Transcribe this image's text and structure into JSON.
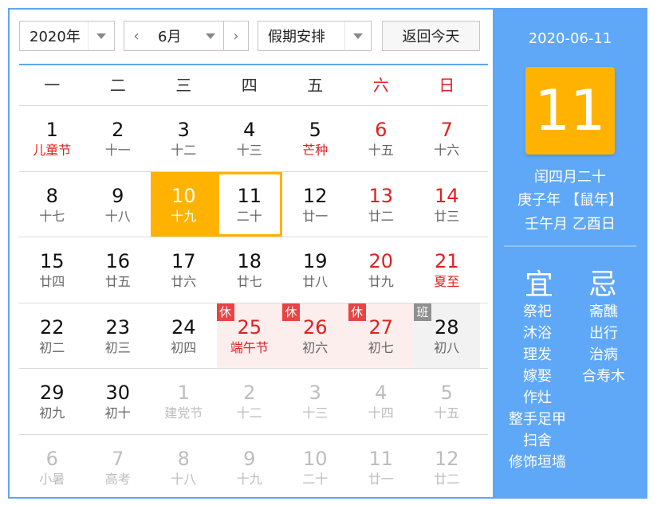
{
  "toolbar": {
    "year": "2020年",
    "month": "6月",
    "holiday": "假期安排",
    "prev": "‹",
    "next": "›",
    "today_btn": "返回今天"
  },
  "weekdays": [
    "一",
    "二",
    "三",
    "四",
    "五",
    "六",
    "日"
  ],
  "rows": [
    [
      {
        "d": "1",
        "l": "儿童节",
        "cls": "fest"
      },
      {
        "d": "2",
        "l": "十一",
        "cls": ""
      },
      {
        "d": "3",
        "l": "十二",
        "cls": ""
      },
      {
        "d": "4",
        "l": "十三",
        "cls": ""
      },
      {
        "d": "5",
        "l": "芒种",
        "cls": "fest"
      },
      {
        "d": "6",
        "l": "十五",
        "cls": "we"
      },
      {
        "d": "7",
        "l": "十六",
        "cls": "we"
      }
    ],
    [
      {
        "d": "8",
        "l": "十七",
        "cls": ""
      },
      {
        "d": "9",
        "l": "十八",
        "cls": ""
      },
      {
        "d": "10",
        "l": "十九",
        "cls": "sel"
      },
      {
        "d": "11",
        "l": "二十",
        "cls": "today"
      },
      {
        "d": "12",
        "l": "廿一",
        "cls": ""
      },
      {
        "d": "13",
        "l": "廿二",
        "cls": "we"
      },
      {
        "d": "14",
        "l": "廿三",
        "cls": "we"
      }
    ],
    [
      {
        "d": "15",
        "l": "廿四",
        "cls": ""
      },
      {
        "d": "16",
        "l": "廿五",
        "cls": ""
      },
      {
        "d": "17",
        "l": "廿六",
        "cls": ""
      },
      {
        "d": "18",
        "l": "廿七",
        "cls": ""
      },
      {
        "d": "19",
        "l": "廿八",
        "cls": ""
      },
      {
        "d": "20",
        "l": "廿九",
        "cls": "we"
      },
      {
        "d": "21",
        "l": "夏至",
        "cls": "we fest"
      }
    ],
    [
      {
        "d": "22",
        "l": "初二",
        "cls": ""
      },
      {
        "d": "23",
        "l": "初三",
        "cls": ""
      },
      {
        "d": "24",
        "l": "初四",
        "cls": ""
      },
      {
        "d": "25",
        "l": "端午节",
        "cls": "hol we fest",
        "badge": "休"
      },
      {
        "d": "26",
        "l": "初六",
        "cls": "hol we",
        "badge": "休"
      },
      {
        "d": "27",
        "l": "初七",
        "cls": "hol we",
        "badge": "休"
      },
      {
        "d": "28",
        "l": "初八",
        "cls": "work",
        "badge": "班"
      }
    ],
    [
      {
        "d": "29",
        "l": "初九",
        "cls": ""
      },
      {
        "d": "30",
        "l": "初十",
        "cls": ""
      },
      {
        "d": "1",
        "l": "建党节",
        "cls": "other"
      },
      {
        "d": "2",
        "l": "十二",
        "cls": "other"
      },
      {
        "d": "3",
        "l": "十三",
        "cls": "other"
      },
      {
        "d": "4",
        "l": "十四",
        "cls": "other"
      },
      {
        "d": "5",
        "l": "十五",
        "cls": "other"
      }
    ],
    [
      {
        "d": "6",
        "l": "小暑",
        "cls": "other"
      },
      {
        "d": "7",
        "l": "高考",
        "cls": "other"
      },
      {
        "d": "8",
        "l": "十八",
        "cls": "other"
      },
      {
        "d": "9",
        "l": "十九",
        "cls": "other"
      },
      {
        "d": "10",
        "l": "二十",
        "cls": "other"
      },
      {
        "d": "11",
        "l": "廿一",
        "cls": "other"
      },
      {
        "d": "12",
        "l": "廿二",
        "cls": "other"
      }
    ]
  ],
  "panel": {
    "date": "2020-06-11",
    "day": "11",
    "lunar": "闰四月二十",
    "ganzhi_year": "庚子年 【鼠年】",
    "ganzhi_md": "壬午月 乙酉日",
    "yi_title": "宜",
    "ji_title": "忌",
    "yi": [
      "祭祀",
      "沐浴",
      "理发",
      "嫁娶",
      "作灶",
      "整手足甲",
      "扫舍",
      "修饰垣墙"
    ],
    "ji": [
      "斋醮",
      "出行",
      "治病",
      "合寿木"
    ]
  },
  "colors": {
    "accent": "#5fa8f8",
    "highlight": "#ffb300",
    "holiday_badge": "#e94444",
    "workday_badge": "#8f8f8f"
  }
}
